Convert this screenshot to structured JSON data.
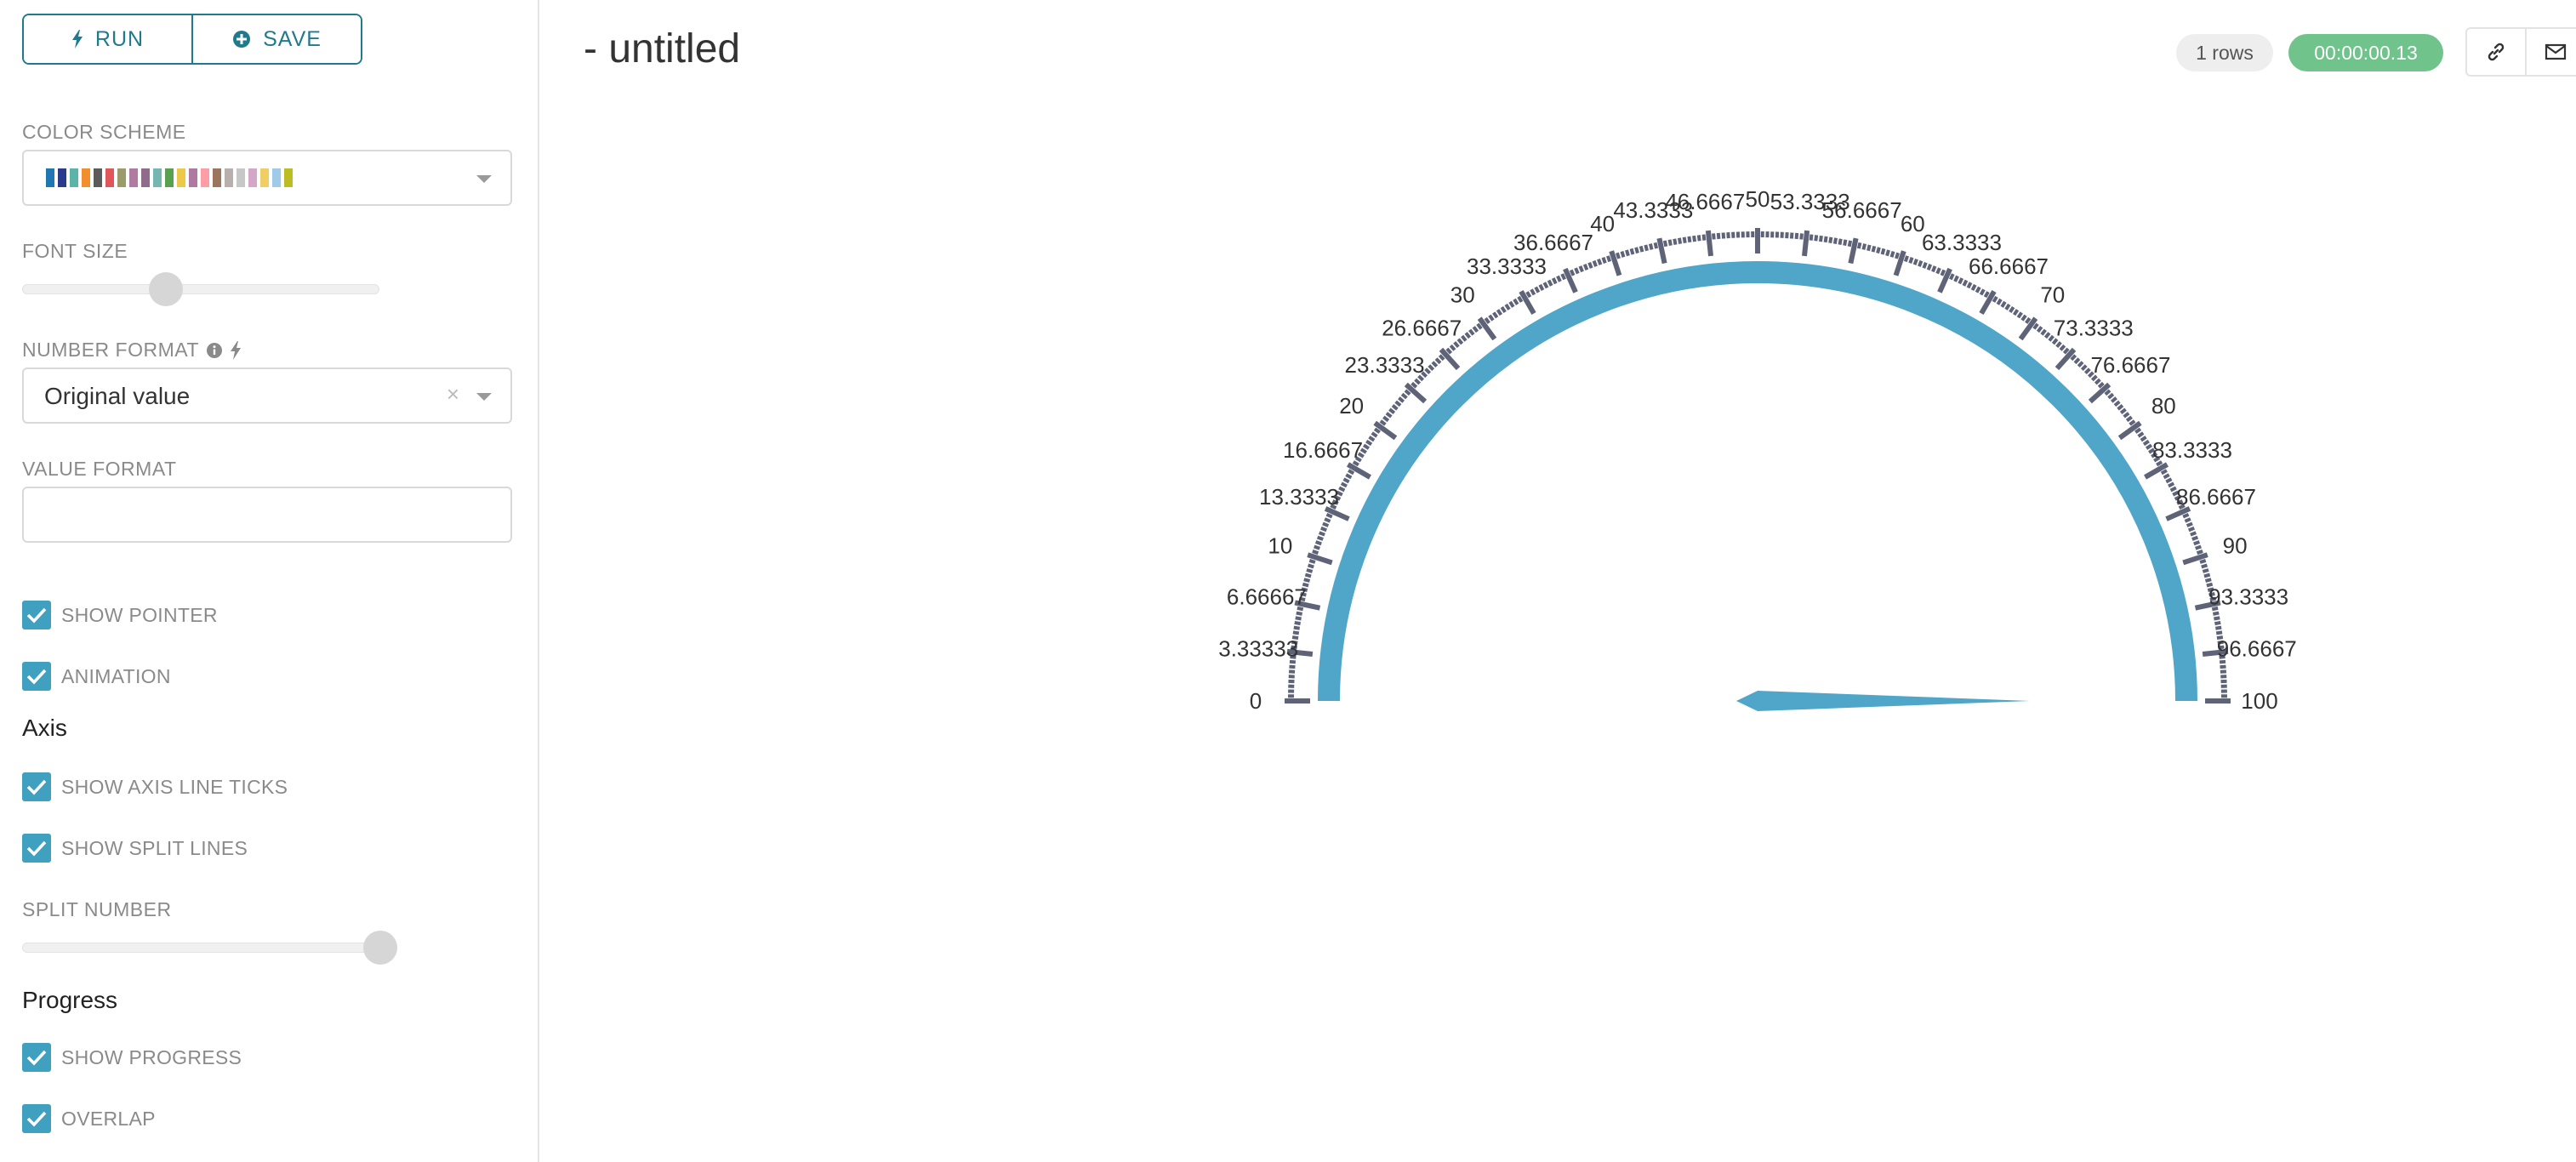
{
  "toolbar": {
    "run_label": "RUN",
    "save_label": "SAVE"
  },
  "controls": {
    "color_scheme": {
      "label": "COLOR SCHEME",
      "swatches": [
        "#1f77b4",
        "#2a3a8c",
        "#5ab4a8",
        "#f28e2c",
        "#5b5b5b",
        "#e15759",
        "#9c9c6a",
        "#b07aa1",
        "#8e6c8a",
        "#76b7b2",
        "#59a14f",
        "#edc949",
        "#af7aa1",
        "#ff9da7",
        "#9c755f",
        "#bab0ab",
        "#c7c7c7",
        "#d4a6c8",
        "#f1ce63",
        "#a0cbe8",
        "#bcbd22"
      ]
    },
    "font_size": {
      "label": "FONT SIZE",
      "value_fraction": 0.4
    },
    "number_format": {
      "label": "NUMBER FORMAT",
      "info_icon": "info-circle-icon",
      "bolt_icon": "bolt-icon",
      "value": "Original value"
    },
    "value_format": {
      "label": "VALUE FORMAT",
      "value": ""
    },
    "show_pointer": {
      "label": "SHOW POINTER",
      "checked": true
    },
    "animation": {
      "label": "ANIMATION",
      "checked": true
    },
    "axis_section": "Axis",
    "show_axis_line_ticks": {
      "label": "SHOW AXIS LINE TICKS",
      "checked": true
    },
    "show_split_lines": {
      "label": "SHOW SPLIT LINES",
      "checked": true
    },
    "split_number": {
      "label": "SPLIT NUMBER",
      "value_fraction": 1.0
    },
    "progress_section": "Progress",
    "show_progress": {
      "label": "SHOW PROGRESS",
      "checked": true
    },
    "overlap": {
      "label": "OVERLAP",
      "checked": true
    }
  },
  "header": {
    "title": "- untitled",
    "rows_badge": "1 rows",
    "time_badge": "00:00:00.13",
    "link_icon": "link-icon",
    "mail_icon": "mail-icon"
  },
  "colors": {
    "accent": "#1f7a8c",
    "gauge": "#4fa6c8",
    "tick": "#5f6378",
    "success": "#6fc38b"
  },
  "chart_data": {
    "type": "gauge",
    "min": 0,
    "max": 100,
    "value": 100,
    "tick_labels": [
      "0",
      "3.33333",
      "6.66667",
      "10",
      "13.3333",
      "16.6667",
      "20",
      "23.3333",
      "26.6667",
      "30",
      "33.3333",
      "36.6667",
      "40",
      "43.3333",
      "46.6667",
      "50",
      "53.3333",
      "56.6667",
      "60",
      "63.3333",
      "66.6667",
      "70",
      "73.3333",
      "76.6667",
      "80",
      "83.3333",
      "86.6667",
      "90",
      "93.3333",
      "96.6667",
      "100"
    ]
  }
}
